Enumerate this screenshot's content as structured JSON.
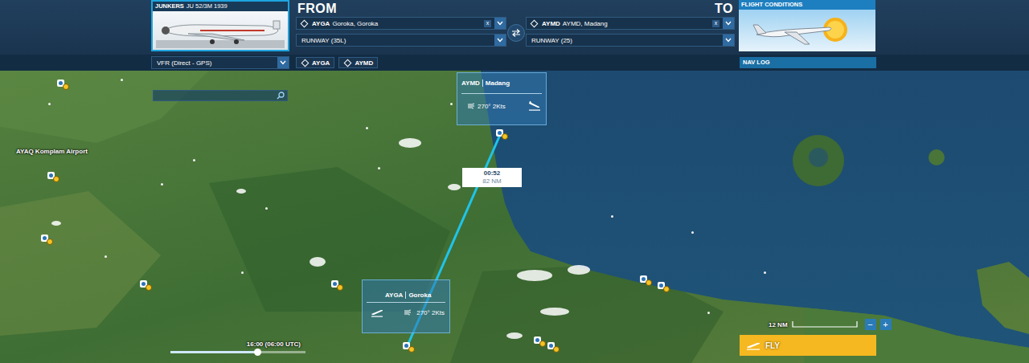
{
  "aircraft": {
    "maker": "JUNKERS",
    "model": "JU 52/3M 1939"
  },
  "from": {
    "heading": "FROM",
    "code": "AYGA",
    "name": "Goroka, Goroka",
    "clear": "x",
    "runway": "RUNWAY (35L)"
  },
  "to": {
    "heading": "TO",
    "code": "AYMD",
    "name": "AYMD, Madang",
    "clear": "x",
    "runway": "RUNWAY (25)"
  },
  "flight_conditions": {
    "label": "FLIGHT CONDITIONS"
  },
  "flight_plan": {
    "type": "VFR (Direct - GPS)"
  },
  "waypoints": [
    {
      "label": "AYGA"
    },
    {
      "label": "AYMD"
    }
  ],
  "nav_log": {
    "label": "NAV LOG"
  },
  "map_labels": [
    {
      "text": "AYAQ Komplam Airport"
    }
  ],
  "destination_card": {
    "code": "AYMD",
    "name": "Madang",
    "wind": "270° 2Kts"
  },
  "departure_card": {
    "code": "AYGA",
    "name": "Goroka",
    "wind": "270° 2Kts"
  },
  "route": {
    "time": "00:52",
    "distance": "82 NM"
  },
  "time_slider": {
    "reading": "16:00 (06:00 UTC)",
    "level": 0.64
  },
  "scale": {
    "reading": "12 NM",
    "zoom_out": "−",
    "zoom_in": "+"
  },
  "fly_button": {
    "label": "FLY"
  }
}
